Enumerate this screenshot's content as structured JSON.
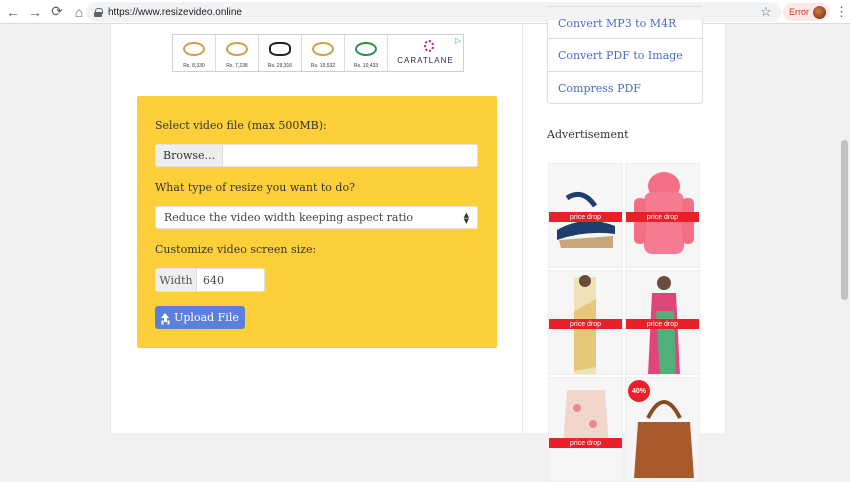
{
  "browser": {
    "url": "https://www.resizevideo.online",
    "status_label": "Error",
    "back_glyph": "←",
    "forward_glyph": "→",
    "reload_glyph": "⟳",
    "home_glyph": "⌂",
    "star_glyph": "☆",
    "menu_glyph": "⋮"
  },
  "banner_ad": {
    "prices": [
      "Rs. 8,330",
      "Rs. 7,238",
      "Rs. 29,316",
      "Rs. 19,532",
      "Rs. 10,433"
    ],
    "brand": "CARATLANE",
    "adchoices_glyph": "▷"
  },
  "form": {
    "file_label": "Select video file (max 500MB):",
    "browse_label": "Browse...",
    "resize_label": "What type of resize you want to do?",
    "resize_selected": "Reduce the video width keeping aspect ratio",
    "screen_size_label": "Customize video screen size:",
    "width_addon": "Width",
    "width_value": "640",
    "upload_label": "Upload File",
    "accent_color": "#fdd03b",
    "button_color": "#5b7fdb"
  },
  "sidebar": {
    "links": [
      "Convert MP3 to M4R",
      "Convert PDF to Image",
      "Compress PDF"
    ],
    "ad_title": "Advertisement",
    "ad_close_glyph": "ⓘ ✕",
    "tiles": [
      {
        "tag": "price drop"
      },
      {
        "tag": "price drop"
      },
      {
        "tag": "price drop"
      },
      {
        "tag": "price drop"
      },
      {
        "tag": "price drop"
      },
      {
        "tag": "40%"
      }
    ],
    "tag_color": "#e8202a"
  }
}
